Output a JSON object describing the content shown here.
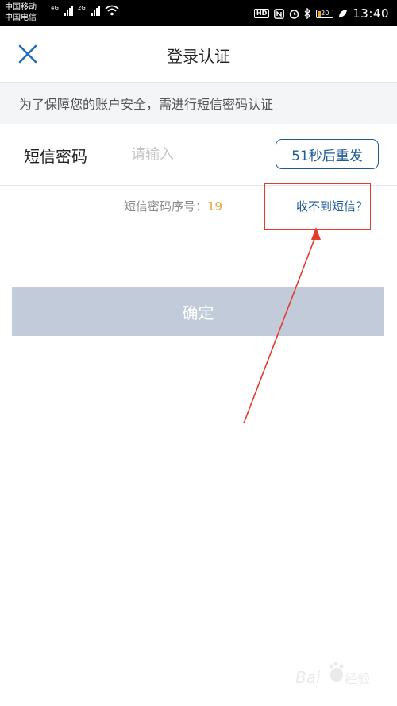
{
  "status_bar": {
    "carrier_1": "中国移动",
    "carrier_2": "中国电信",
    "net_1": "4G",
    "net_2": "2G",
    "hd": "HD",
    "battery": "20",
    "time": "13:40",
    "icons": [
      "signal-icon",
      "wifi-icon",
      "nfc-icon",
      "alarm-icon",
      "bluetooth-icon",
      "battery-icon",
      "leaf-icon"
    ]
  },
  "header": {
    "title": "登录认证",
    "close_icon": "close-icon"
  },
  "notice": {
    "text": "为了保障您的账户安全，需进行短信密码认证"
  },
  "sms": {
    "label": "短信密码",
    "placeholder": "请输入",
    "value": "",
    "resend_label": "51秒后重发"
  },
  "serial": {
    "label": "短信密码序号：",
    "number": "19"
  },
  "help": {
    "link": "收不到短信？"
  },
  "confirm": {
    "label": "确定"
  },
  "colors": {
    "accent": "#1e5b96",
    "confirm_disabled": "#c2cbd9",
    "serial_number": "#e0a33b",
    "annotation": "#e53b2c",
    "notice_bg": "#f4f5f7"
  }
}
